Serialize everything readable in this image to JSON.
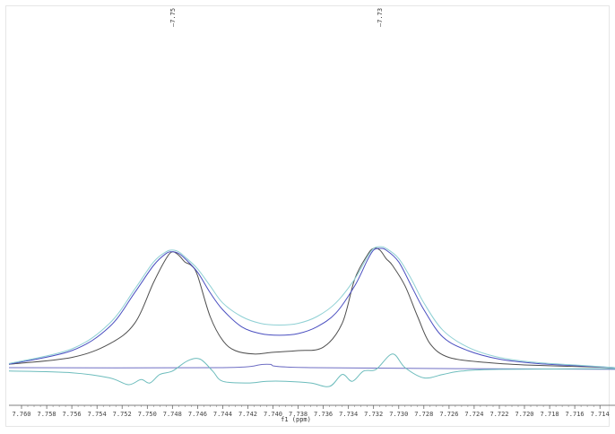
{
  "chart_data": {
    "type": "line",
    "xlabel": "f1 (ppm)",
    "xlim": [
      7.761,
      7.7128
    ],
    "x_reversed": true,
    "ylim": [
      -0.06,
      1.0
    ],
    "grid": false,
    "peak_labels": [
      "7.75",
      "7.73"
    ],
    "peak_positions": [
      7.748,
      7.7315
    ],
    "x_ticks": [
      7.76,
      7.758,
      7.756,
      7.754,
      7.752,
      7.75,
      7.748,
      7.746,
      7.744,
      7.742,
      7.74,
      7.738,
      7.736,
      7.734,
      7.732,
      7.73,
      7.728,
      7.726,
      7.724,
      7.722,
      7.72,
      7.718,
      7.716,
      7.714
    ],
    "x_tick_labels": [
      "7.760",
      "7.758",
      "7.756",
      "7.754",
      "7.752",
      "7.750",
      "7.748",
      "7.746",
      "7.744",
      "7.742",
      "7.740",
      "7.738",
      "7.736",
      "7.734",
      "7.732",
      "7.730",
      "7.728",
      "7.726",
      "7.724",
      "7.722",
      "7.720",
      "7.718",
      "7.716",
      "7.714"
    ],
    "series": [
      {
        "color": "#4f4f4f",
        "x": [
          7.761,
          7.756,
          7.753,
          7.751,
          7.7495,
          7.7485,
          7.748,
          7.7475,
          7.747,
          7.7465,
          7.746,
          7.745,
          7.744,
          7.743,
          7.7415,
          7.74,
          7.738,
          7.736,
          7.7345,
          7.7335,
          7.7325,
          7.732,
          7.7315,
          7.731,
          7.7305,
          7.7295,
          7.7285,
          7.7275,
          7.726,
          7.723,
          7.72,
          7.7128
        ],
        "y": [
          0.01,
          0.03,
          0.07,
          0.13,
          0.25,
          0.32,
          0.34,
          0.33,
          0.31,
          0.3,
          0.27,
          0.15,
          0.08,
          0.05,
          0.04,
          0.045,
          0.05,
          0.06,
          0.13,
          0.26,
          0.33,
          0.35,
          0.345,
          0.32,
          0.3,
          0.24,
          0.15,
          0.07,
          0.03,
          0.015,
          0.008,
          0.0
        ]
      },
      {
        "color": "#4a4fc0",
        "x": [
          7.761,
          7.756,
          7.753,
          7.751,
          7.7495,
          7.7485,
          7.748,
          7.7475,
          7.747,
          7.746,
          7.745,
          7.744,
          7.7425,
          7.741,
          7.7395,
          7.738,
          7.7365,
          7.735,
          7.7335,
          7.7325,
          7.732,
          7.7315,
          7.731,
          7.73,
          7.729,
          7.728,
          7.7265,
          7.7245,
          7.722,
          7.719,
          7.716,
          7.7128
        ],
        "y": [
          0.01,
          0.05,
          0.12,
          0.22,
          0.3,
          0.335,
          0.34,
          0.335,
          0.32,
          0.28,
          0.22,
          0.17,
          0.12,
          0.1,
          0.095,
          0.1,
          0.12,
          0.16,
          0.24,
          0.315,
          0.345,
          0.35,
          0.345,
          0.31,
          0.24,
          0.17,
          0.09,
          0.05,
          0.025,
          0.012,
          0.006,
          0.0
        ]
      },
      {
        "color": "#8fd0d4",
        "x": [
          7.761,
          7.756,
          7.753,
          7.751,
          7.7495,
          7.7485,
          7.748,
          7.7475,
          7.747,
          7.746,
          7.745,
          7.744,
          7.7425,
          7.741,
          7.7395,
          7.738,
          7.7365,
          7.735,
          7.7335,
          7.7325,
          7.732,
          7.7315,
          7.731,
          7.73,
          7.729,
          7.728,
          7.7265,
          7.7245,
          7.722,
          7.719,
          7.716,
          7.7128
        ],
        "y": [
          0.012,
          0.055,
          0.13,
          0.23,
          0.31,
          0.34,
          0.345,
          0.34,
          0.325,
          0.29,
          0.24,
          0.19,
          0.15,
          0.13,
          0.125,
          0.13,
          0.15,
          0.19,
          0.26,
          0.325,
          0.35,
          0.355,
          0.35,
          0.32,
          0.26,
          0.19,
          0.11,
          0.06,
          0.03,
          0.015,
          0.008,
          0.0
        ]
      },
      {
        "color": "#6f6fc4",
        "x": [
          7.761,
          7.744,
          7.7405,
          7.737,
          7.7128
        ],
        "y": [
          0.0,
          0.0,
          0.01,
          0.0,
          -0.005
        ]
      },
      {
        "color": "#6cbcbc",
        "x": [
          7.761,
          7.756,
          7.753,
          7.7515,
          7.7505,
          7.7498,
          7.749,
          7.748,
          7.7468,
          7.7458,
          7.7448,
          7.744,
          7.742,
          7.7405,
          7.739,
          7.737,
          7.7355,
          7.7345,
          7.7337,
          7.7328,
          7.7318,
          7.7305,
          7.7295,
          7.728,
          7.7265,
          7.725,
          7.722,
          7.7128
        ],
        "y": [
          -0.01,
          -0.015,
          -0.03,
          -0.05,
          -0.035,
          -0.045,
          -0.02,
          -0.01,
          0.02,
          0.025,
          -0.01,
          -0.04,
          -0.045,
          -0.04,
          -0.04,
          -0.045,
          -0.055,
          -0.02,
          -0.04,
          -0.01,
          -0.005,
          0.04,
          0.0,
          -0.03,
          -0.02,
          -0.01,
          -0.005,
          -0.003
        ]
      }
    ]
  }
}
